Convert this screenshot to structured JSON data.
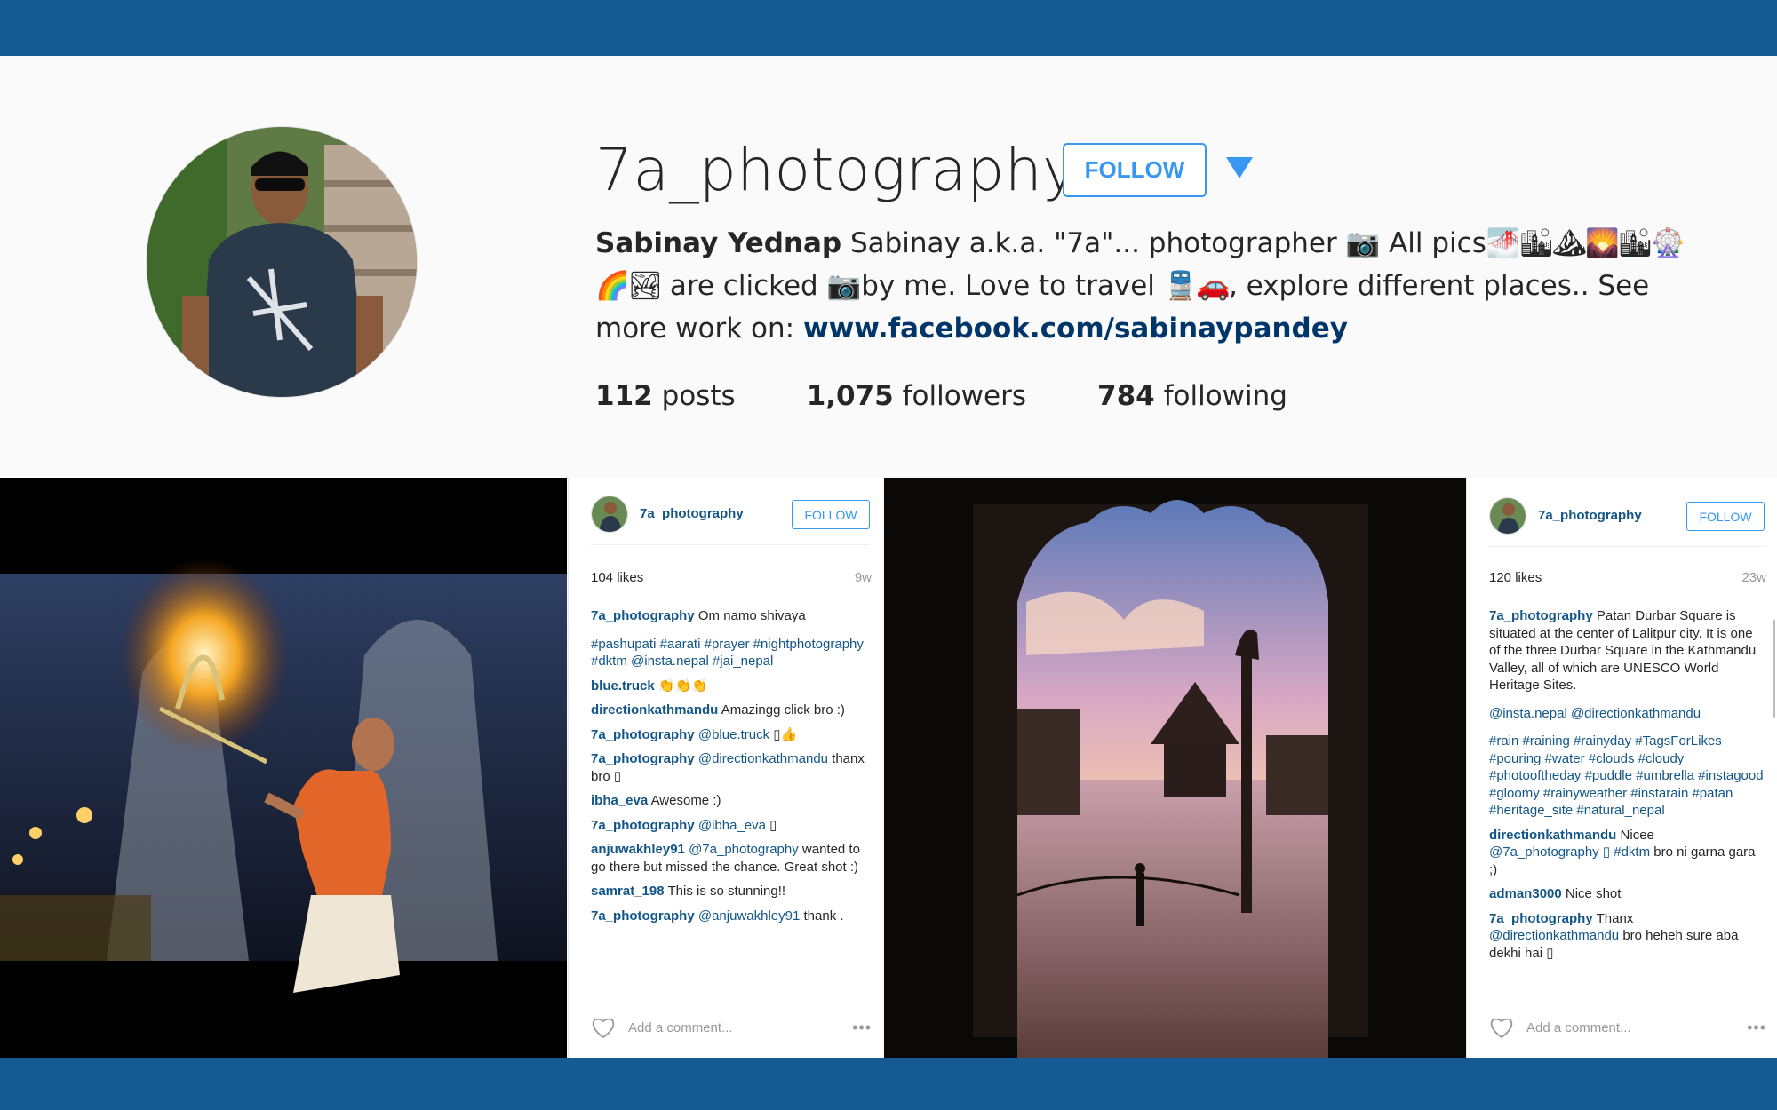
{
  "profile": {
    "username": "7a_photography",
    "follow_label": "FOLLOW",
    "full_name": "Sabinay Yednap",
    "bio_part1": " Sabinay a.k.a. \"7a\"... photographer ",
    "bio_part2": " All pics",
    "bio_part3": " are clicked ",
    "bio_part4": "by me. Love to travel ",
    "bio_part5": ", explore different places.. See more work on: ",
    "link": "www.facebook.com/sabinaypandey",
    "stats": {
      "posts_count": "112",
      "posts_label": "posts",
      "followers_count": "1,075",
      "followers_label": "followers",
      "following_count": "784",
      "following_label": "following"
    }
  },
  "posts": [
    {
      "username": "7a_photography",
      "follow_label": "FOLLOW",
      "likes": "104 likes",
      "age": "9w",
      "caption_user": "7a_photography",
      "caption": "Om namo shivaya",
      "hashtags": "#pashupati #aarati #prayer #nightphotography #dktm @insta.nepal #jai_nepal",
      "comments": [
        {
          "user": "blue.truck",
          "text": "👏👏👏"
        },
        {
          "user": "directionkathmandu",
          "text": "Amazingg click bro :)"
        },
        {
          "user": "7a_photography",
          "mention": "@blue.truck",
          "text": "▯👍"
        },
        {
          "user": "7a_photography",
          "mention": "@directionkathmandu",
          "text": "thanx bro ▯"
        },
        {
          "user": "ibha_eva",
          "text": "Awesome :)"
        },
        {
          "user": "7a_photography",
          "mention": "@ibha_eva",
          "text": "▯"
        },
        {
          "user": "anjuwakhley91",
          "mention": "@7a_photography",
          "text": "wanted to go there but missed the chance. Great shot :)"
        },
        {
          "user": "samrat_198",
          "text": "This is so stunning!!"
        },
        {
          "user": "7a_photography",
          "mention": "@anjuwakhley91",
          "text": "thank ."
        }
      ],
      "add_comment_placeholder": "Add a comment...",
      "more_dots": "•••"
    },
    {
      "username": "7a_photography",
      "follow_label": "FOLLOW",
      "likes": "120 likes",
      "age": "23w",
      "caption_user": "7a_photography",
      "caption": "Patan Durbar Square is situated at the center of Lalitpur city. It is one of the three Durbar Square in the Kathmandu Valley, all of which are UNESCO World Heritage Sites.",
      "mentions": "@insta.nepal @directionkathmandu",
      "hashtags": "#rain #raining #rainyday #TagsForLikes #pouring #water #clouds #cloudy #photooftheday #puddle #umbrella #instagood #gloomy #rainyweather #instarain #patan #heritage_site #natural_nepal",
      "comments": [
        {
          "user": "directionkathmandu",
          "text": "Nicee",
          "mention": "@7a_photography ▯ #dktm",
          "tail": "bro ni garna gara ;)"
        },
        {
          "user": "adman3000",
          "text": "Nice shot"
        },
        {
          "user": "7a_photography",
          "text": "Thanx",
          "mention": "@directionkathmandu",
          "tail": "bro heheh sure aba dekhi hai ▯"
        }
      ],
      "add_comment_placeholder": "Add a comment...",
      "more_dots": "•••"
    }
  ],
  "colors": {
    "brand_bar": "#155a92",
    "follow_blue": "#3897f0",
    "link_blue": "#125688"
  }
}
